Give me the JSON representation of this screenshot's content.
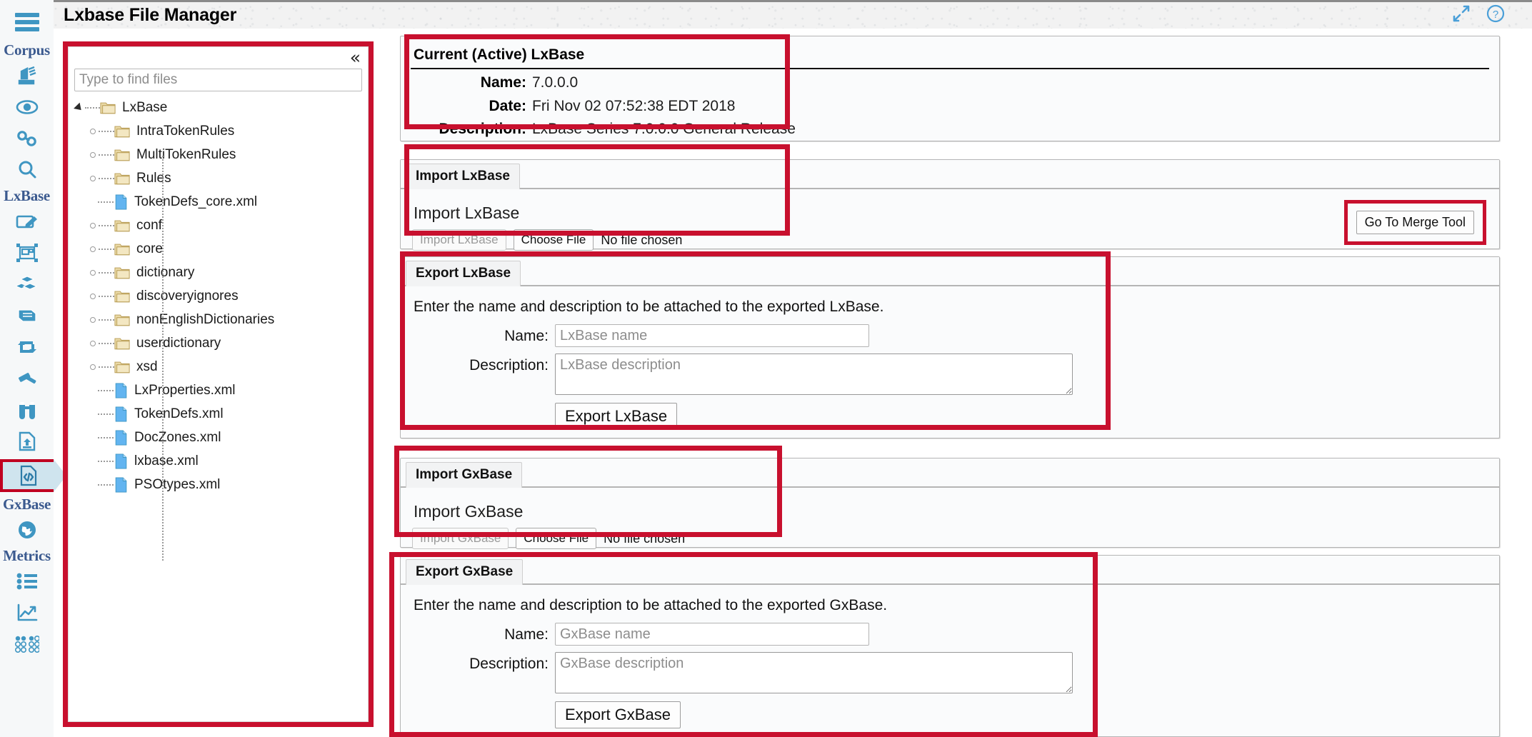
{
  "titlebar": {
    "title": "Lxbase File Manager",
    "expand_icon": "expand-arrows-icon",
    "help_icon": "question-circle-icon"
  },
  "rail": {
    "menu_icon": "hamburger-menu-icon",
    "groups": [
      {
        "label": "Corpus",
        "icons": [
          "documents-stack-icon",
          "eye-icon",
          "link-chain-icon",
          "magnifier-icon"
        ]
      },
      {
        "label": "LxBase",
        "icons": [
          "edit-pencil-icon",
          "layout-frame-icon",
          "blocks-icon",
          "book-icon",
          "refresh-loop-icon",
          "gavel-icon",
          "binoculars-icon",
          "file-upload-icon",
          "code-file-icon"
        ]
      },
      {
        "label": "GxBase",
        "icons": [
          "globe-icon"
        ]
      },
      {
        "label": "Metrics",
        "icons": [
          "list-icon",
          "trend-chart-icon",
          "dots-grid-icon"
        ]
      }
    ],
    "selected_icon": "code-file-icon"
  },
  "tree": {
    "collapse_icon": "double-chevron-left-icon",
    "search_placeholder": "Type to find files",
    "search_value": "",
    "nodes": [
      {
        "label": "LxBase",
        "type": "folder",
        "depth": 0,
        "expanded": true
      },
      {
        "label": "IntraTokenRules",
        "type": "folder",
        "depth": 1,
        "expanded": false
      },
      {
        "label": "MultiTokenRules",
        "type": "folder",
        "depth": 1,
        "expanded": false
      },
      {
        "label": "Rules",
        "type": "folder",
        "depth": 1,
        "expanded": false
      },
      {
        "label": "TokenDefs_core.xml",
        "type": "file",
        "depth": 1,
        "expanded": false
      },
      {
        "label": "conf",
        "type": "folder",
        "depth": 1,
        "expanded": false
      },
      {
        "label": "core",
        "type": "folder",
        "depth": 1,
        "expanded": false
      },
      {
        "label": "dictionary",
        "type": "folder",
        "depth": 1,
        "expanded": false
      },
      {
        "label": "discoveryignores",
        "type": "folder",
        "depth": 1,
        "expanded": false
      },
      {
        "label": "nonEnglishDictionaries",
        "type": "folder",
        "depth": 1,
        "expanded": false
      },
      {
        "label": "userdictionary",
        "type": "folder",
        "depth": 1,
        "expanded": false
      },
      {
        "label": "xsd",
        "type": "folder",
        "depth": 1,
        "expanded": false
      },
      {
        "label": "LxProperties.xml",
        "type": "file",
        "depth": 1,
        "expanded": false
      },
      {
        "label": "TokenDefs.xml",
        "type": "file",
        "depth": 1,
        "expanded": false
      },
      {
        "label": "DocZones.xml",
        "type": "file",
        "depth": 1,
        "expanded": false
      },
      {
        "label": "lxbase.xml",
        "type": "file",
        "depth": 1,
        "expanded": false
      },
      {
        "label": "PSOtypes.xml",
        "type": "file",
        "depth": 1,
        "expanded": false
      }
    ]
  },
  "current_lxbase": {
    "heading": "Current (Active) LxBase",
    "name_label": "Name:",
    "name_value": "7.0.0.0",
    "date_label": "Date:",
    "date_value": "Fri Nov 02 07:52:38 EDT 2018",
    "description_label": "Description:",
    "description_value": "LxBase Series 7.0.0.0 General Release"
  },
  "import_lxbase": {
    "tab_label": "Import LxBase",
    "section_title": "Import LxBase",
    "import_button": "Import LxBase",
    "choose_file_button": "Choose File",
    "no_file_text": "No file chosen",
    "merge_button": "Go To Merge Tool"
  },
  "export_lxbase": {
    "tab_label": "Export LxBase",
    "instruction": "Enter the name and description to be attached to the exported LxBase.",
    "name_label": "Name:",
    "name_placeholder": "LxBase name",
    "name_value": "",
    "description_label": "Description:",
    "description_placeholder": "LxBase description",
    "description_value": "",
    "export_button": "Export LxBase"
  },
  "import_gxbase": {
    "tab_label": "Import GxBase",
    "section_title": "Import GxBase",
    "import_button": "Import GxBase",
    "choose_file_button": "Choose File",
    "no_file_text": "No file chosen"
  },
  "export_gxbase": {
    "tab_label": "Export GxBase",
    "instruction": "Enter the name and description to be attached to the exported GxBase.",
    "name_label": "Name:",
    "name_placeholder": "GxBase name",
    "name_value": "",
    "description_label": "Description:",
    "description_placeholder": "GxBase description",
    "description_value": "",
    "export_button": "Export GxBase"
  },
  "colors": {
    "annotation_red": "#c8102e",
    "rail_accent": "#3f96c2",
    "rail_label": "#3b5a8f",
    "selected_bg": "#cfe4ee"
  }
}
